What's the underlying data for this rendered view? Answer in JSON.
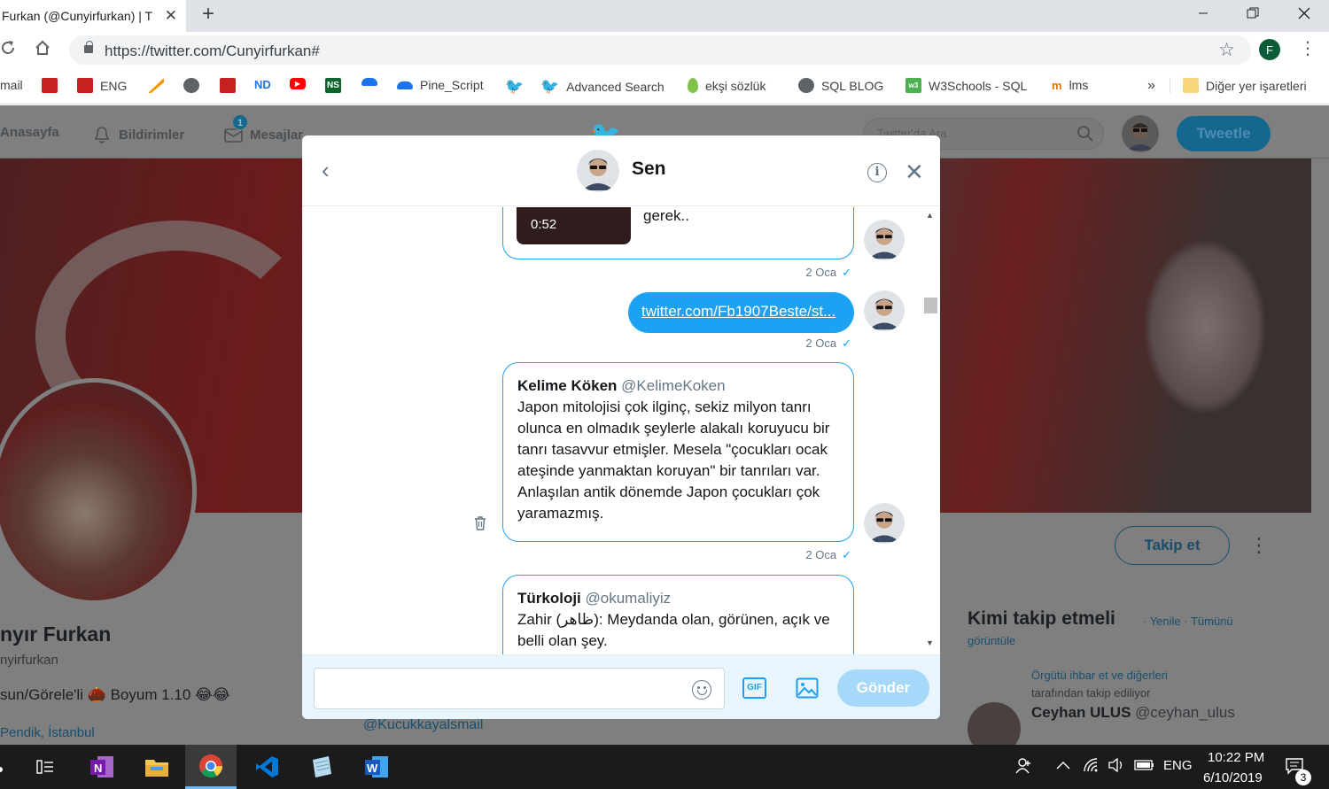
{
  "browser": {
    "tab_title": "Furkan (@Cunyirfurkan) | T",
    "tab_close": "✕",
    "new_tab": "+",
    "url": "https://twitter.com/Cunyirfurkan#",
    "profile_initial": "F",
    "bookmarks": [
      {
        "label": "mail",
        "icon": "mail-icon",
        "color": "#c5221f"
      },
      {
        "label": "",
        "icon": "book-icon",
        "color": "#c5221f"
      },
      {
        "label": "ENG",
        "icon": "book-icon",
        "color": "#c5221f"
      },
      {
        "label": "",
        "icon": "pencil-icon",
        "color": "#f29900"
      },
      {
        "label": "",
        "icon": "globe-icon",
        "color": "#5f6368"
      },
      {
        "label": "",
        "icon": "book-red-icon",
        "color": "#c5221f"
      },
      {
        "label": "ND",
        "icon": "nd-icon",
        "color": "#1a73e8"
      },
      {
        "label": "",
        "icon": "youtube-icon",
        "color": "#ff0000"
      },
      {
        "label": "",
        "icon": "ns-icon",
        "color": "#0d652d"
      },
      {
        "label": "",
        "icon": "cloud-icon",
        "color": "#1a73e8"
      },
      {
        "label": "Pine_Script",
        "icon": "cloud-icon",
        "color": "#1a73e8"
      },
      {
        "label": "",
        "icon": "twitter-icon",
        "color": "#1da1f2"
      },
      {
        "label": "Advanced Search",
        "icon": "twitter-icon",
        "color": "#1da1f2"
      },
      {
        "label": "ekşi sözlük",
        "icon": "drop-icon",
        "color": "#81c14b"
      },
      {
        "label": "SQL BLOG",
        "icon": "globe-icon",
        "color": "#5f6368"
      },
      {
        "label": "W3Schools - SQL",
        "icon": "w3-icon",
        "color": "#4caf50"
      },
      {
        "label": "lms",
        "icon": "lms-icon",
        "color": "#e37400"
      }
    ],
    "more_bookmarks": "»",
    "other_bookmarks": "Diğer yer işaretleri"
  },
  "twitter": {
    "nav": {
      "home": "Anasayfa",
      "notifications": "Bildirimler",
      "messages": "Mesajlar",
      "messages_badge": "1",
      "search_placeholder": "Twitter'da Ara",
      "tweet_button": "Tweetle"
    },
    "profile": {
      "name": "nyır Furkan",
      "handle": "nyirfurkan",
      "bio": "sun/Görele'li 🌰 Boyum 1.10 😂😂",
      "location": "Pendik, İstanbul",
      "follow_button": "Takip et",
      "more": "⋮"
    },
    "who_to_follow": {
      "title": "Kimi takip etmeli",
      "links": "· Yenile · Tümünü görüntüle",
      "note_link": "Örgütü ihbar et ve diğerleri",
      "note_text": "tarafından takip ediliyor",
      "user_name": "Ceyhan ULUS",
      "user_handle": "@ceyhan_ulus"
    },
    "behind_link": "@Kucukkayalsmail"
  },
  "dm": {
    "title": "Sen",
    "back": "‹",
    "close": "✕",
    "info": "i",
    "messages": [
      {
        "type": "video",
        "duration": "0:52",
        "text": "bulmuş hali bu soytarı olsa gerek..",
        "timestamp": "2 Oca"
      },
      {
        "type": "link",
        "text": "twitter.com/Fb1907Beste/st...",
        "timestamp": "2 Oca"
      },
      {
        "type": "tweet",
        "user": "Kelime Köken",
        "handle": "@KelimeKoken",
        "text": "Japon mitolojisi çok ilginç, sekiz milyon tanrı olunca en olmadık şeylerle alakalı koruyucu bir tanrı tasavvur etmişler. Mesela \"çocukları ocak ateşinde yanmaktan koruyan\" bir tanrıları var. Anlaşılan antik dönemde Japon çocukları çok yaramazmış.",
        "timestamp": "2 Oca"
      },
      {
        "type": "tweet",
        "user": "Türkoloji",
        "handle": "@okumaliyiz",
        "text": "Zahir (ظاهر): Meydanda olan, görünen, açık ve belli olan şey."
      }
    ],
    "tick": "✓",
    "composer": {
      "placeholder": "",
      "gif": "GIF",
      "send": "Gönder"
    }
  },
  "taskbar": {
    "lang": "ENG",
    "time": "10:22 PM",
    "date": "6/10/2019",
    "notifications": "3"
  }
}
